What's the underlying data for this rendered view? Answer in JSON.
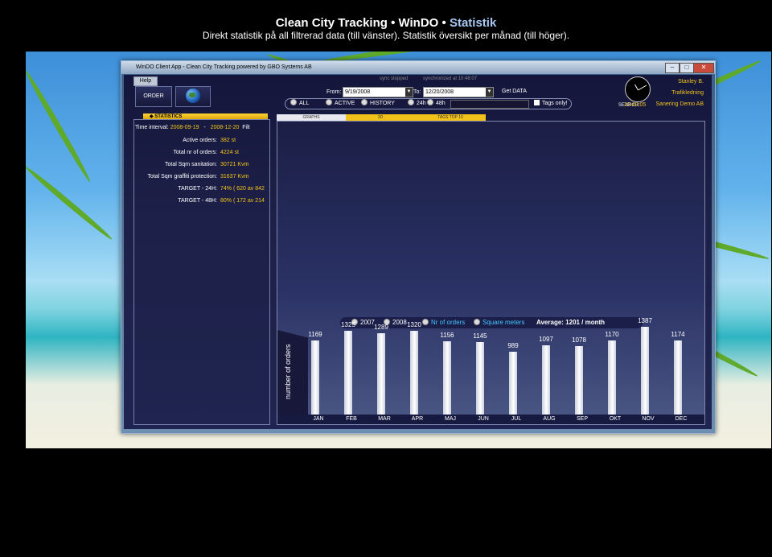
{
  "caption": {
    "title_main": "Clean City Tracking • WinDO • ",
    "title_accent": "Statistik",
    "subtitle": "Direkt statistik på all filtrerad data (till vänster). Statistik översikt per månad (till höger)."
  },
  "window": {
    "title": "WinDO Client App - Clean City Tracking powered by GBO Systems AB"
  },
  "toolbar": {
    "help": "Help",
    "order": "ORDER",
    "status_left": "sync stopped",
    "status_right": "synchronized at 10:48:07",
    "from_label": "From:",
    "from_value": "9/19/2008",
    "to_label": "To:",
    "to_value": "12/20/2008",
    "get_data": "Get DATA"
  },
  "filters": {
    "all": "ALL",
    "active": "ACTIVE",
    "history": "HISTORY",
    "h24": "24h",
    "h48": "48h",
    "search_label": "SEARCH:",
    "tags_only": "Tags only!"
  },
  "user": {
    "name": "Stanley B.",
    "role": "Trafikledning",
    "company": "Sanering Demo AB",
    "clock": "10:49:05"
  },
  "stats": {
    "tab_label": "STATISTICS",
    "time_interval_label": "Time interval:",
    "time_from": "2008-09-19",
    "time_dash": "-",
    "time_to": "2008-12-20",
    "time_suffix": "Filt",
    "rows": [
      {
        "label": "Active orders:",
        "value": "382 st"
      },
      {
        "label": "Total nr of orders:",
        "value": "4224 st"
      },
      {
        "label": "Total Sqm sanitation:",
        "value": "30721 Kvm"
      },
      {
        "label": "Total Sqm graffiti protection:",
        "value": "31637 Kvm"
      },
      {
        "label": "TARGET - 24H:",
        "value": "74%  ( 620 av 842"
      },
      {
        "label": "TARGET - 48H:",
        "value": "80%  ( 172 av 214"
      }
    ]
  },
  "chart_tabs": [
    "GRAPHS",
    "3D",
    "TAGS TOP 10"
  ],
  "chart_legend": {
    "y2007": "2007",
    "y2008": "2008",
    "nr_orders": "Nr of orders",
    "square_meters": "Square meters",
    "average": "Average: 1201 / month"
  },
  "chart_data": {
    "type": "bar",
    "ylabel": "number of orders",
    "categories": [
      "JAN",
      "FEB",
      "MAR",
      "APR",
      "MAJ",
      "JUN",
      "JUL",
      "AUG",
      "SEP",
      "OKT",
      "NOV",
      "DEC"
    ],
    "values": [
      1169,
      1325,
      1289,
      1320,
      1156,
      1145,
      989,
      1097,
      1078,
      1170,
      1387,
      1174
    ],
    "value_labels": [
      "1169",
      "1325",
      "1289",
      "1320",
      "1156",
      "1145",
      "989",
      "1097",
      "1078",
      "1170",
      "1387",
      "1174"
    ],
    "ylim": [
      0,
      1400
    ]
  }
}
